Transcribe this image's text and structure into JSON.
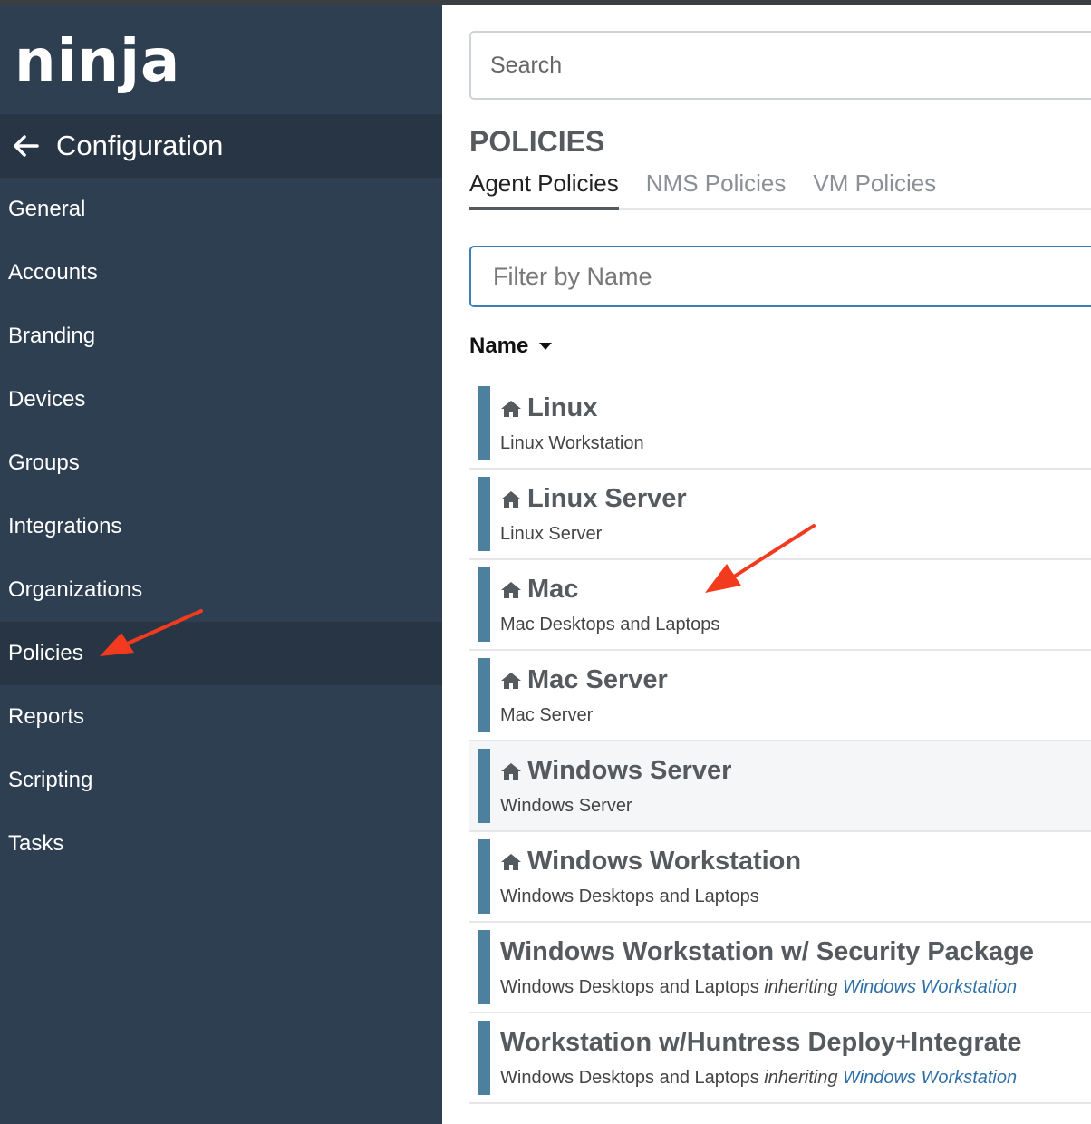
{
  "brand": {
    "logo_text": "ninja"
  },
  "search": {
    "placeholder": "Search"
  },
  "sidebar": {
    "header": {
      "title": "Configuration"
    },
    "items": [
      {
        "label": "General"
      },
      {
        "label": "Accounts"
      },
      {
        "label": "Branding"
      },
      {
        "label": "Devices"
      },
      {
        "label": "Groups"
      },
      {
        "label": "Integrations"
      },
      {
        "label": "Organizations"
      },
      {
        "label": "Policies",
        "active": true
      },
      {
        "label": "Reports"
      },
      {
        "label": "Scripting"
      },
      {
        "label": "Tasks"
      }
    ]
  },
  "main": {
    "heading": "POLICIES",
    "tabs": [
      {
        "label": "Agent Policies",
        "active": true
      },
      {
        "label": "NMS Policies"
      },
      {
        "label": "VM Policies"
      }
    ],
    "filter": {
      "placeholder": "Filter by Name"
    },
    "sort_header": {
      "label": "Name"
    },
    "policies": [
      {
        "name": "Linux",
        "subtitle": "Linux Workstation",
        "icon": "home-icon"
      },
      {
        "name": "Linux Server",
        "subtitle": "Linux Server",
        "icon": "home-icon"
      },
      {
        "name": "Mac",
        "subtitle": "Mac Desktops and Laptops",
        "icon": "home-icon"
      },
      {
        "name": "Mac Server",
        "subtitle": "Mac Server",
        "icon": "home-icon"
      },
      {
        "name": "Windows Server",
        "subtitle": "Windows Server",
        "icon": "home-icon"
      },
      {
        "name": "Windows Workstation",
        "subtitle": "Windows Desktops and Laptops",
        "icon": "home-icon"
      },
      {
        "name": "Windows Workstation w/ Security Package",
        "subtitle": "Windows Desktops and Laptops",
        "inherit_word": "inheriting",
        "inherit_link": "Windows Workstation"
      },
      {
        "name": "Workstation w/Huntress Deploy+Integrate",
        "subtitle": "Windows Desktops and Laptops",
        "inherit_word": "inheriting",
        "inherit_link": "Windows Workstation"
      }
    ]
  },
  "colors": {
    "sidebar_bg": "#2e3f51",
    "sidebar_active": "#273544",
    "row_bar": "#4d7f9e",
    "link": "#2f6fa8",
    "annotation_arrow": "#f23b1e"
  }
}
